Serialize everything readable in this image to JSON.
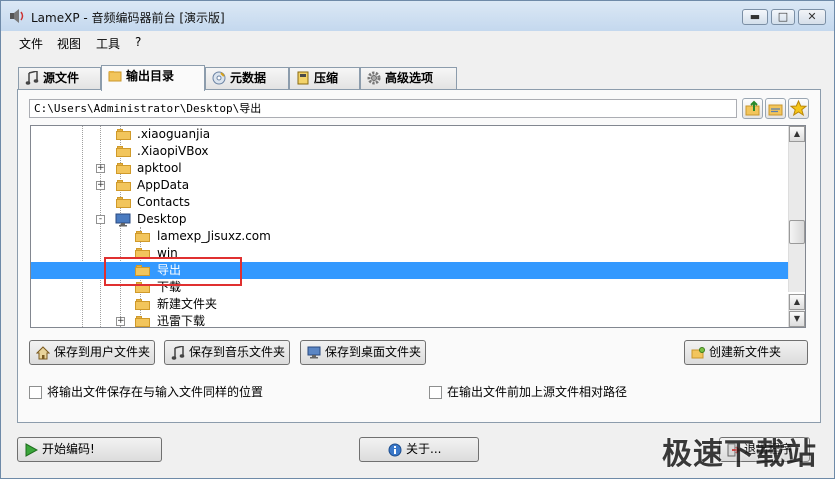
{
  "window": {
    "title": "LameXP - 音频编码器前台 [演示版]"
  },
  "menu": [
    "文件",
    "视图",
    "工具",
    "?"
  ],
  "tabs": [
    {
      "label": "源文件",
      "icon": "music-note-icon"
    },
    {
      "label": "输出目录",
      "icon": "folder-icon",
      "active": true
    },
    {
      "label": "元数据",
      "icon": "disc-icon"
    },
    {
      "label": "压缩",
      "icon": "book-icon"
    },
    {
      "label": "高级选项",
      "icon": "gear-icon"
    }
  ],
  "path": {
    "value": "C:\\Users\\Administrator\\Desktop\\导出"
  },
  "tree": {
    "items": [
      {
        "label": ".xiaoguanjia",
        "expander": ""
      },
      {
        "label": ".XiaopiVBox",
        "expander": ""
      },
      {
        "label": "apktool",
        "expander": "+"
      },
      {
        "label": "AppData",
        "expander": "+"
      },
      {
        "label": "Contacts",
        "expander": ""
      },
      {
        "label": "Desktop",
        "expander": "-"
      },
      {
        "label": "lamexp_Jisuxz.com",
        "expander": ""
      },
      {
        "label": "win",
        "expander": ""
      },
      {
        "label": "导出",
        "expander": "",
        "selected": true
      },
      {
        "label": "下载",
        "expander": ""
      },
      {
        "label": "新建文件夹",
        "expander": ""
      },
      {
        "label": "迅雷下载",
        "expander": "+"
      }
    ]
  },
  "buttons": {
    "save_user": "保存到用户文件夹",
    "save_music": "保存到音乐文件夹",
    "save_desktop": "保存到桌面文件夹",
    "create_folder": "创建新文件夹",
    "start": "开始编码!",
    "about": "关于...",
    "exit": "退出程序"
  },
  "checkboxes": {
    "same_location": "将输出文件保存在与输入文件同样的位置",
    "relative_path": "在输出文件前加上源文件相对路径"
  },
  "watermark": "极速下载站",
  "colors": {
    "selection": "#3399ff",
    "highlight_box": "#e03030"
  }
}
